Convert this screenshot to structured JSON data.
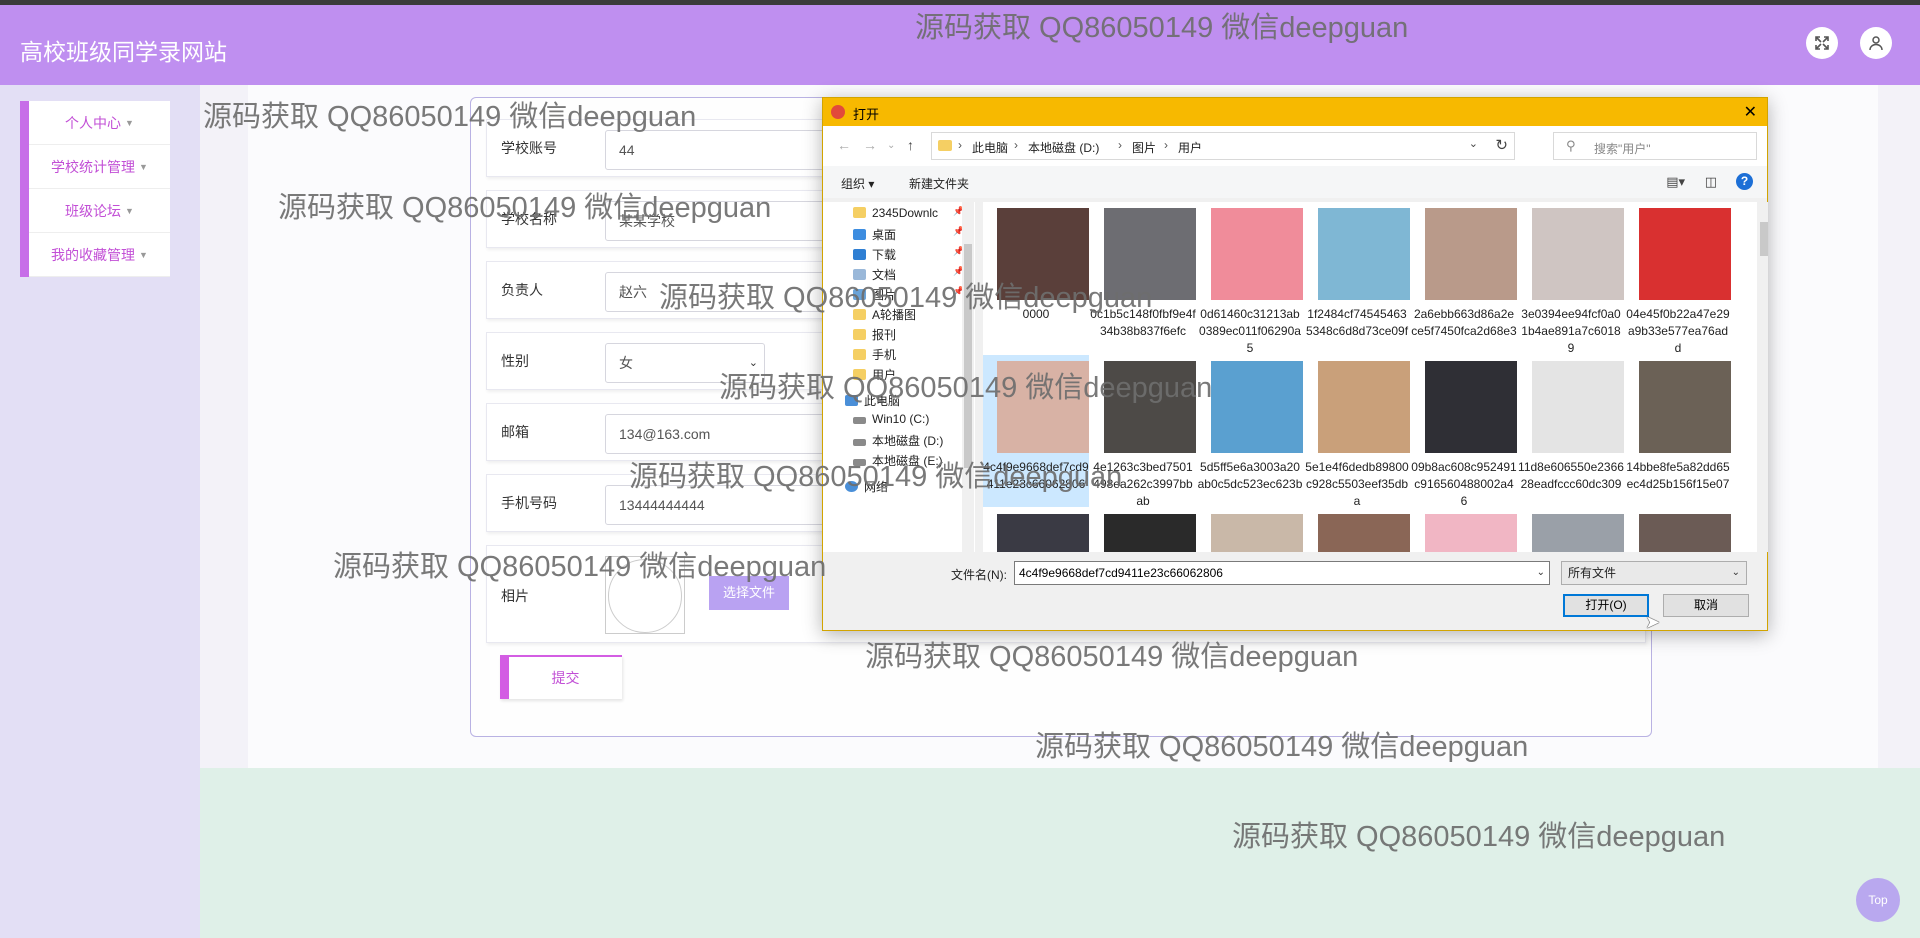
{
  "header": {
    "site_title": "高校班级同学录网站",
    "fullscreen_icon": "fullscreen-icon",
    "user_icon": "user-icon"
  },
  "sidebar": {
    "items": [
      {
        "label": "个人中心"
      },
      {
        "label": "学校统计管理"
      },
      {
        "label": "班级论坛"
      },
      {
        "label": "我的收藏管理"
      }
    ]
  },
  "form": {
    "school_account": {
      "label": "学校账号",
      "value": "44"
    },
    "school_name": {
      "label": "学校名称",
      "value": "某某学校"
    },
    "principal": {
      "label": "负责人",
      "value": "赵六"
    },
    "gender": {
      "label": "性别",
      "value": "女"
    },
    "email": {
      "label": "邮箱",
      "value": "134@163.com"
    },
    "phone": {
      "label": "手机号码",
      "value": "13444444444"
    },
    "photo": {
      "label": "相片",
      "choose_file": "选择文件"
    },
    "submit_label": "提交"
  },
  "top_button": "Top",
  "watermark": "源码获取 QQ86050149 微信deepguan",
  "dialog": {
    "title": "打开",
    "breadcrumb": [
      "此电脑",
      "本地磁盘 (D:)",
      "图片",
      "用户"
    ],
    "search_placeholder": "搜索\"用户\"",
    "organize": "组织 ▾",
    "new_folder": "新建文件夹",
    "nav_items": [
      {
        "label": "2345Downlc",
        "icon": "folder"
      },
      {
        "label": "桌面",
        "icon": "desktop"
      },
      {
        "label": "下载",
        "icon": "download"
      },
      {
        "label": "文档",
        "icon": "document"
      },
      {
        "label": "图片",
        "icon": "pictures"
      },
      {
        "label": "A轮播图",
        "icon": "folder"
      },
      {
        "label": "报刊",
        "icon": "folder"
      },
      {
        "label": "手机",
        "icon": "folder"
      },
      {
        "label": "用户",
        "icon": "folder"
      },
      {
        "label": "此电脑",
        "icon": "pc"
      },
      {
        "label": "Win10 (C:)",
        "icon": "drive"
      },
      {
        "label": "本地磁盘 (D:)",
        "icon": "drive"
      },
      {
        "label": "本地磁盘 (E:)",
        "icon": "drive"
      },
      {
        "label": "网络",
        "icon": "network"
      }
    ],
    "files": [
      {
        "name": "0000",
        "color": "#5a3f3a"
      },
      {
        "name": "0c1b5c148f0fbf9e4f34b38b837f6efc",
        "color": "#6d6d72"
      },
      {
        "name": "0d61460c31213ab0389ec011f06290a5",
        "color": "#f08c9a"
      },
      {
        "name": "1f2484cf745454635348c6d8d73ce09f",
        "color": "#7fb7d4"
      },
      {
        "name": "2a6ebb663d86a2ece5f7450fca2d68e3",
        "color": "#b99a8a"
      },
      {
        "name": "3e0394ee94fcf0a01b4ae891a7c60189",
        "color": "#cfc5c2"
      },
      {
        "name": "04e45f0b22a47e29a9b33e577ea76add",
        "color": "#d93030"
      },
      {
        "name": "4c4f9e9668def7cd9411e23c66062806",
        "color": "#d8b2a5"
      },
      {
        "name": "4e1263c3bed7501498ea262c3997bbab",
        "color": "#4d4a47"
      },
      {
        "name": "5d5ff5e6a3003a20ab0c5dc523ec623b",
        "color": "#5aa0d0"
      },
      {
        "name": "5e1e4f6dedb89800c928c5503eef35dba",
        "color": "#c9a07a"
      },
      {
        "name": "09b8ac608c952491c916560488002a46",
        "color": "#2f2f35"
      },
      {
        "name": "11d8e606550e236628eadfccc60dc309",
        "color": "#e4e4e4"
      },
      {
        "name": "14bbe8fe5a82dd65ec4d25b156f15e07",
        "color": "#6b6156"
      },
      {
        "name": "",
        "color": "#3a3a44"
      },
      {
        "name": "",
        "color": "#2a2a2a"
      },
      {
        "name": "",
        "color": "#c9b8a8"
      },
      {
        "name": "",
        "color": "#8a6656"
      },
      {
        "name": "",
        "color": "#f1b6c4"
      },
      {
        "name": "",
        "color": "#9aa0a8"
      },
      {
        "name": "",
        "color": "#6b5b55"
      }
    ],
    "filename_label": "文件名(N):",
    "filename_value": "4c4f9e9668def7cd9411e23c66062806",
    "filetype": "所有文件",
    "open_button": "打开(O)",
    "cancel_button": "取消"
  },
  "colors": {
    "header": "#bf8ff0",
    "accent": "#c76ee8",
    "dialog_title": "#f7b900"
  }
}
